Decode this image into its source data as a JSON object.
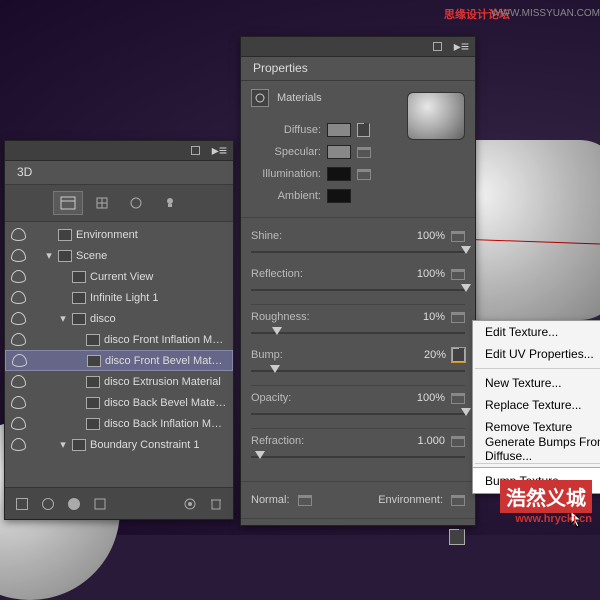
{
  "watermarks": {
    "top_label_cn": "思缘设计论坛",
    "top_url": "WWW.MISSYUAN.COM",
    "bottom_cn": "浩然义城",
    "bottom_url": "www.hryckj.cn"
  },
  "panel3d": {
    "title": "3D",
    "tree": [
      {
        "label": "Environment",
        "indent": 0,
        "twist": "",
        "icon": "env"
      },
      {
        "label": "Scene",
        "indent": 0,
        "twist": "▾",
        "icon": "scene"
      },
      {
        "label": "Current View",
        "indent": 1,
        "twist": "",
        "icon": "cam"
      },
      {
        "label": "Infinite Light 1",
        "indent": 1,
        "twist": "",
        "icon": "light"
      },
      {
        "label": "disco",
        "indent": 1,
        "twist": "▾",
        "icon": "mesh"
      },
      {
        "label": "disco Front Inflation Mat...",
        "indent": 2,
        "twist": "",
        "icon": "mat"
      },
      {
        "label": "disco Front Bevel Material",
        "indent": 2,
        "twist": "",
        "icon": "mat",
        "sel": true
      },
      {
        "label": "disco Extrusion Material",
        "indent": 2,
        "twist": "",
        "icon": "mat"
      },
      {
        "label": "disco Back Bevel Material",
        "indent": 2,
        "twist": "",
        "icon": "mat"
      },
      {
        "label": "disco Back Inflation Mate...",
        "indent": 2,
        "twist": "",
        "icon": "mat"
      },
      {
        "label": "Boundary Constraint 1",
        "indent": 1,
        "twist": "▾",
        "icon": "const"
      }
    ]
  },
  "props": {
    "title": "Properties",
    "subtitle": "Materials",
    "swatches": {
      "diffuse": "Diffuse:",
      "specular": "Specular:",
      "illumination": "Illumination:",
      "ambient": "Ambient:"
    },
    "sliders": [
      {
        "key": "shine",
        "label": "Shine:",
        "value": "100%",
        "pos": 98
      },
      {
        "key": "reflection",
        "label": "Reflection:",
        "value": "100%",
        "pos": 98
      },
      {
        "key": "roughness",
        "label": "Roughness:",
        "value": "10%",
        "pos": 10
      },
      {
        "key": "bump",
        "label": "Bump:",
        "value": "20%",
        "pos": 9,
        "hilite": true
      },
      {
        "key": "opacity",
        "label": "Opacity:",
        "value": "100%",
        "pos": 98
      },
      {
        "key": "refraction",
        "label": "Refraction:",
        "value": "1.000",
        "pos": 2
      }
    ],
    "normal": "Normal:",
    "environment": "Environment:"
  },
  "context_menu": {
    "items": [
      {
        "label": "Edit Texture..."
      },
      {
        "label": "Edit UV Properties..."
      },
      {
        "sep": true
      },
      {
        "label": "New Texture..."
      },
      {
        "label": "Replace Texture..."
      },
      {
        "label": "Remove Texture"
      },
      {
        "label": "Generate Bumps From Diffuse...",
        "disabled": false
      },
      {
        "sep": true
      },
      {
        "label": "Bump Texture",
        "header": true
      }
    ]
  }
}
